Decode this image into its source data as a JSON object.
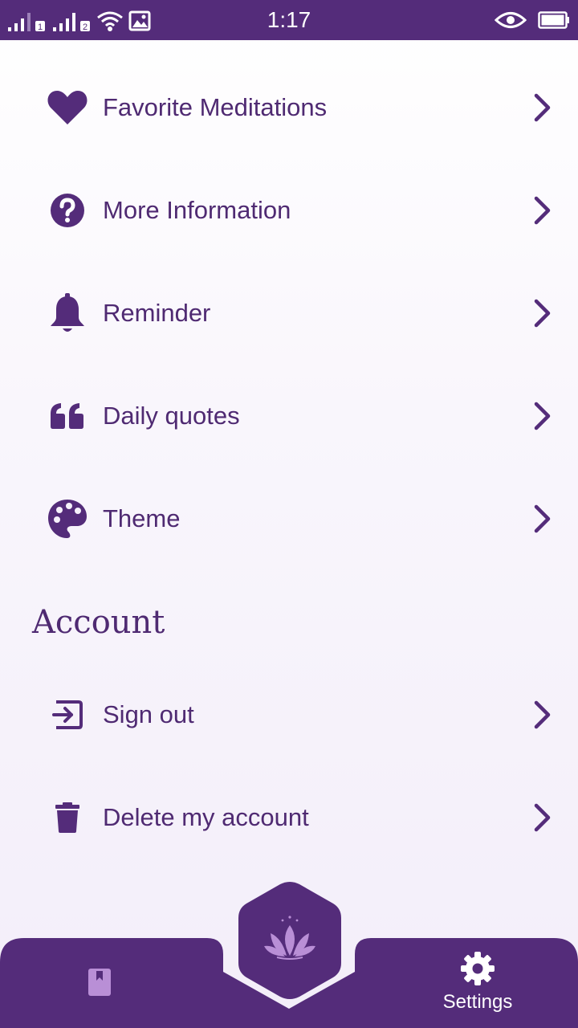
{
  "status_bar": {
    "time": "1:17",
    "sim1_label": "1",
    "sim2_label": "2"
  },
  "menu": {
    "items": [
      {
        "label": "Favorite Meditations",
        "icon": "heart-icon"
      },
      {
        "label": "More Information",
        "icon": "question-circle-icon"
      },
      {
        "label": "Reminder",
        "icon": "bell-icon"
      },
      {
        "label": "Daily quotes",
        "icon": "quote-icon"
      },
      {
        "label": "Theme",
        "icon": "palette-icon"
      }
    ]
  },
  "account": {
    "title": "Account",
    "items": [
      {
        "label": "Sign out",
        "icon": "sign-out-icon"
      },
      {
        "label": "Delete my account",
        "icon": "trash-icon"
      }
    ]
  },
  "bottom_nav": {
    "journal_icon": "journal-icon",
    "home_icon": "lotus-icon",
    "settings_label": "Settings",
    "settings_icon": "gear-icon"
  },
  "colors": {
    "primary": "#542c7a",
    "text": "#4f2a72",
    "accent_light": "#b98fd6"
  }
}
